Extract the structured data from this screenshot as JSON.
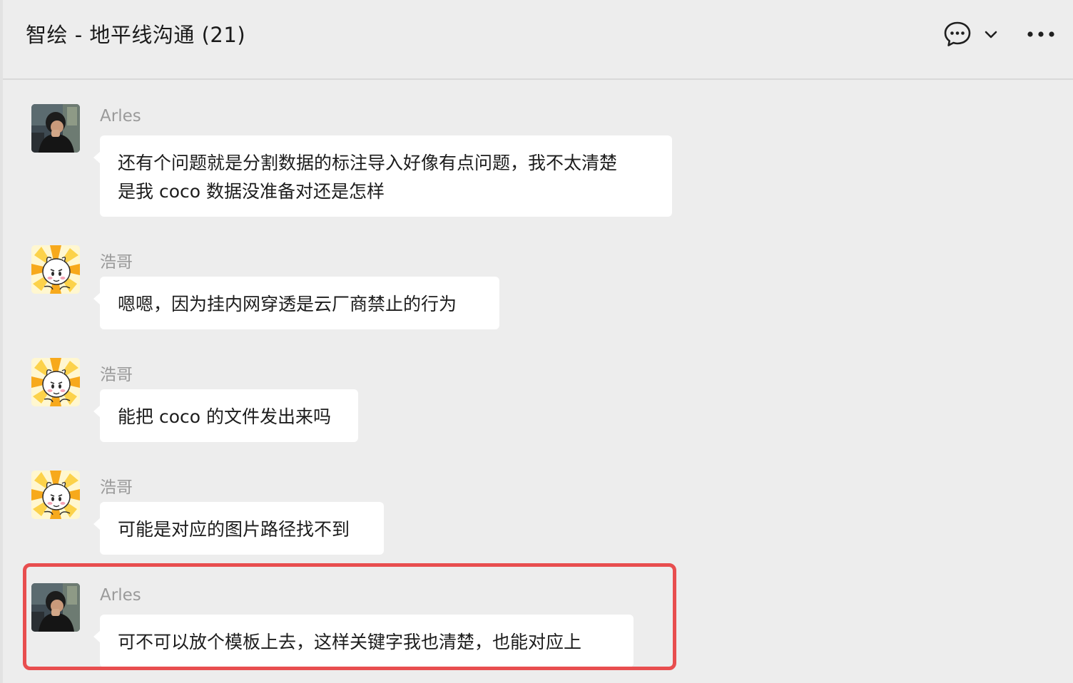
{
  "header": {
    "title": "智绘 - 地平线沟通 (21)"
  },
  "messages": [
    {
      "sender": "Arles",
      "avatar": "arles-photo",
      "lines": [
        "还有个问题就是分割数据的标注导入好像有点问题，我不太清楚",
        "是我 coco 数据没准备对还是怎样"
      ]
    },
    {
      "sender": "浩哥",
      "avatar": "cartoon-sun",
      "lines": [
        "嗯嗯，因为挂内网穿透是云厂商禁止的行为"
      ]
    },
    {
      "sender": "浩哥",
      "avatar": "cartoon-sun",
      "lines": [
        "能把 coco 的文件发出来吗"
      ]
    },
    {
      "sender": "浩哥",
      "avatar": "cartoon-sun",
      "lines": [
        "可能是对应的图片路径找不到"
      ]
    },
    {
      "sender": "Arles",
      "avatar": "arles-photo",
      "lines": [
        "可不可以放个模板上去，这样关键字我也清楚，也能对应上"
      ]
    }
  ],
  "colors": {
    "background": "#ededed",
    "bubble": "#ffffff",
    "highlight": "#e84e4f",
    "sender_name": "#9a9a9a"
  },
  "icons": {
    "chat": "chat-bubble-icon",
    "chevron": "chevron-down-icon",
    "more": "more-dots-icon"
  }
}
